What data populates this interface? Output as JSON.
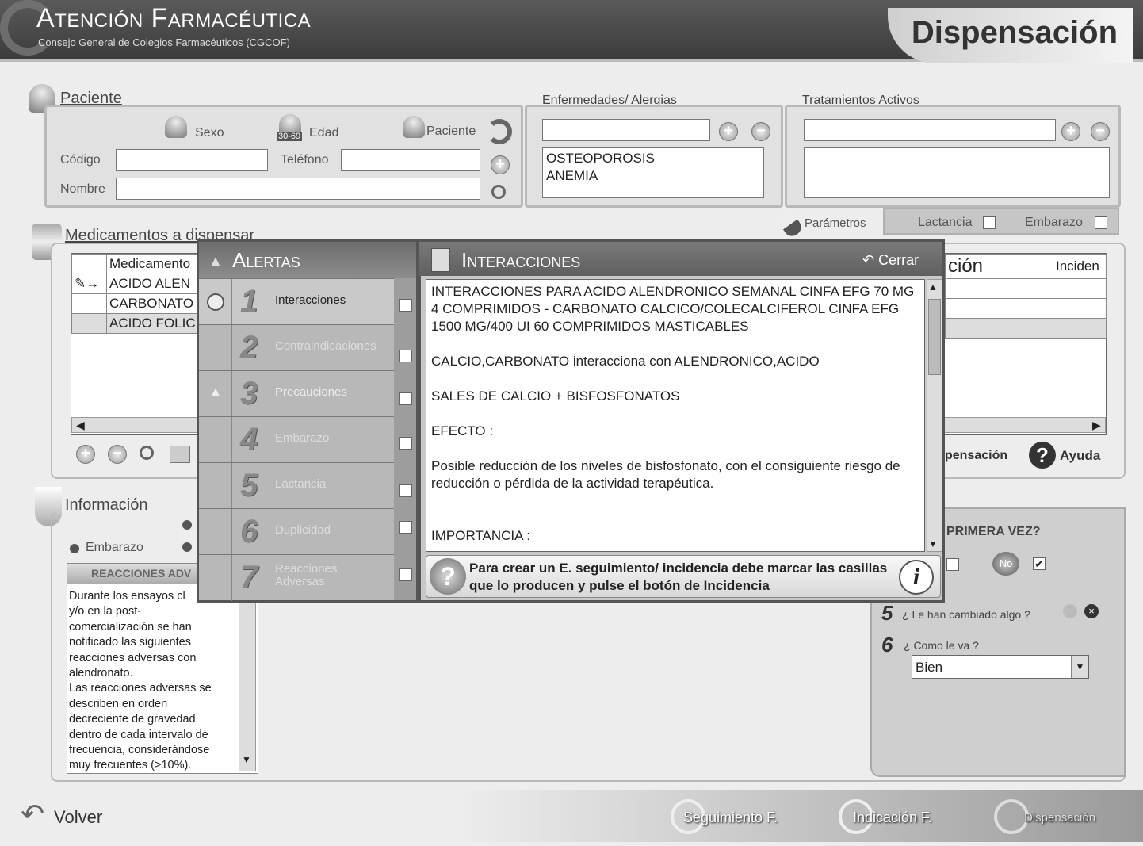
{
  "header": {
    "title": "Atención Farmacéutica",
    "subtitle": "Consejo General de Colegios Farmacéuticos (CGCOF)",
    "screen": "Dispensación"
  },
  "paciente": {
    "section": "Paciente",
    "sexo": "Sexo",
    "edad": "Edad",
    "edad_badge": "30-69",
    "paciente_btn": "Paciente",
    "codigo": "Código",
    "telefono": "Teléfono",
    "nombre": "Nombre"
  },
  "enfermedades": {
    "section": "Enfermedades/ Alergias",
    "items": [
      "OSTEOPOROSIS",
      "ANEMIA"
    ]
  },
  "tratamientos": {
    "section": "Tratamientos Activos"
  },
  "parametros": {
    "label": "Parámetros",
    "lactancia": "Lactancia",
    "embarazo": "Embarazo"
  },
  "medicamentos": {
    "section": "Medicamentos a dispensar",
    "col_med": "Medicamento",
    "col_ion": "ción",
    "col_inc": "Inciden",
    "rows": [
      "ACIDO ALEN",
      "CARBONATO",
      "ACIDO FOLIC"
    ],
    "dispensacion": "pensación",
    "ayuda": "Ayuda"
  },
  "informacion": {
    "section": "Información",
    "embarazo": "Embarazo",
    "reacciones_head": "REACCIONES ADV",
    "text": "Durante los ensayos cl\ny/o en la post-\ncomercialización se han\nnotificado las siguientes\nreacciones adversas con\nalendronato.\nLas reacciones adversas se\ndescriben en orden\ndecreciente de gravedad\ndentro de cada intervalo de\nfrecuencia, considerándose\nmuy frecuentes (>10%)."
  },
  "seguimiento": {
    "primera": "PRIMERA VEZ?",
    "q5num": "5",
    "q5": "¿ Le han cambiado algo ?",
    "q6num": "6",
    "q6": "¿ Como le va ?",
    "select": "Bien"
  },
  "alertas": {
    "title": "Alertas",
    "items": [
      {
        "num": "1",
        "label": "Interacciones"
      },
      {
        "num": "2",
        "label": "Contraindicaciones"
      },
      {
        "num": "3",
        "label": "Precauciones"
      },
      {
        "num": "4",
        "label": "Embarazo"
      },
      {
        "num": "5",
        "label": "Lactancia"
      },
      {
        "num": "6",
        "label": "Duplicidad"
      },
      {
        "num": "7",
        "label": "Reacciones Adversas"
      }
    ]
  },
  "interacciones": {
    "title": "Interacciones",
    "cerrar": "Cerrar",
    "text": "INTERACCIONES PARA ACIDO ALENDRONICO SEMANAL CINFA EFG 70 MG 4 COMPRIMIDOS - CARBONATO CALCICO/COLECALCIFEROL CINFA EFG 1500 MG/400 UI 60 COMPRIMIDOS MASTICABLES\n\nCALCIO,CARBONATO interacciona con ALENDRONICO,ACIDO\n\nSALES DE CALCIO + BISFOSFONATOS\n\nEFECTO :\n\nPosible reducción de los niveles de bisfosfonato, con el consiguiente riesgo de reducción o pérdida de la actividad terapéutica.\n\n\nIMPORTANCIA :",
    "hint": "Para crear un E. seguimiento/ incidencia debe marcar las casillas que lo producen y pulse el botón de Incidencia"
  },
  "footer": {
    "volver": "Volver",
    "seguimiento": "Seguimiento F.",
    "indicacion": "Indicación F.",
    "dispensacion": "Dispensación"
  }
}
